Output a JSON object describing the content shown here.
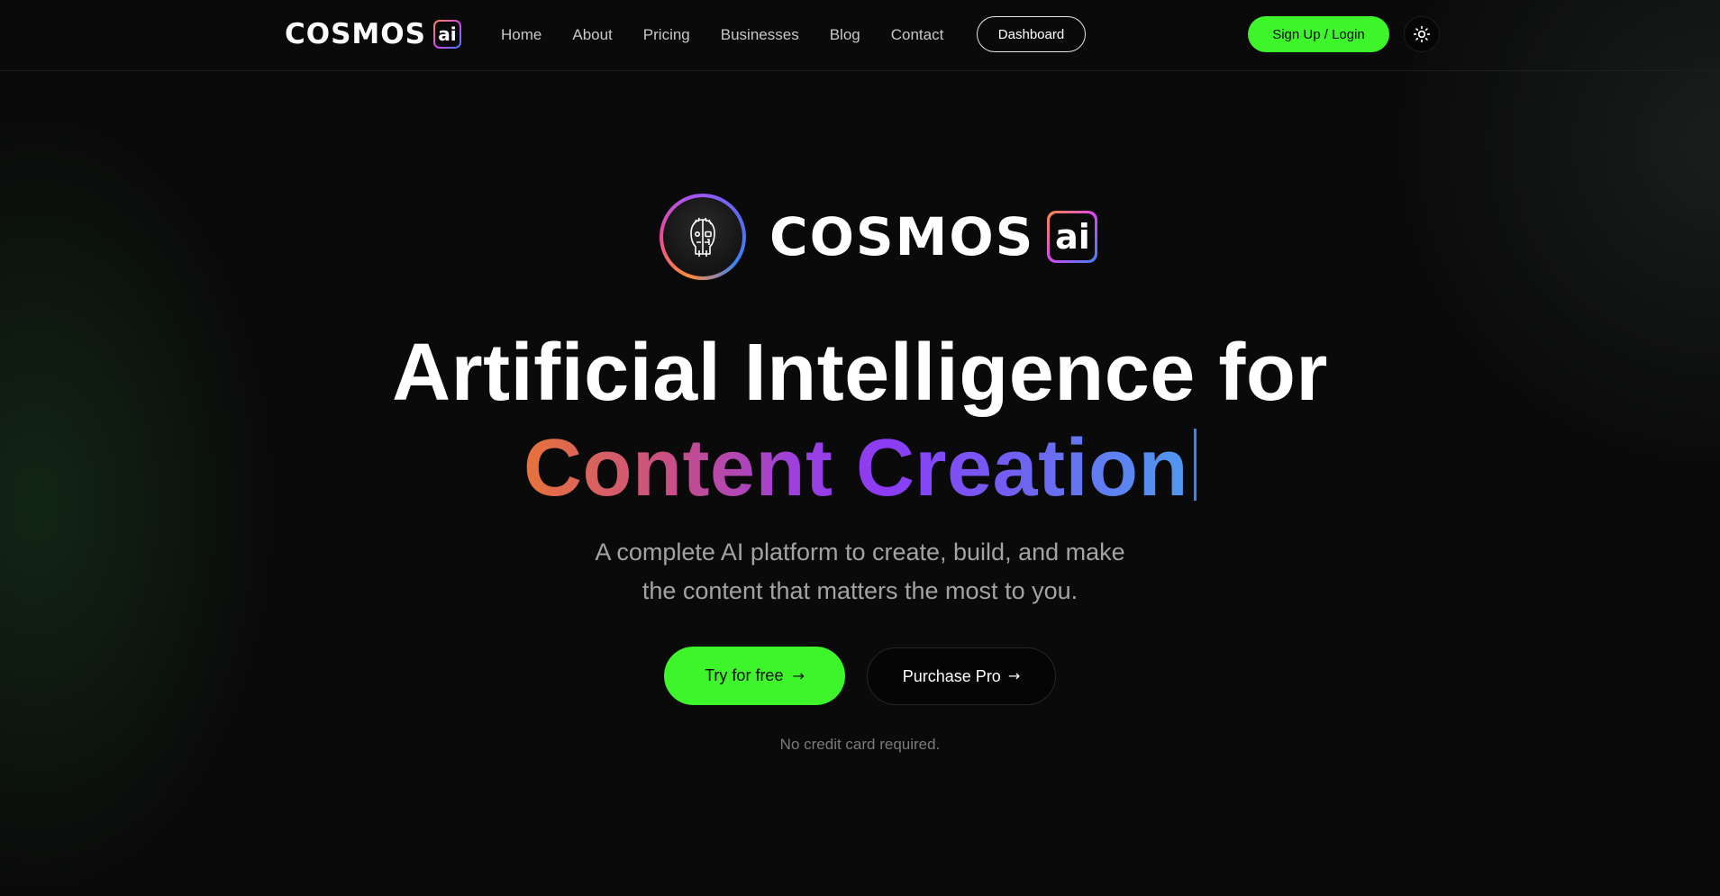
{
  "brand": {
    "wordmark": "COSMOS",
    "badge": "ai"
  },
  "nav": {
    "links": [
      "Home",
      "About",
      "Pricing",
      "Businesses",
      "Blog",
      "Contact"
    ],
    "dashboard_label": "Dashboard",
    "signup_label": "Sign Up / Login",
    "theme_icon": "sun-icon"
  },
  "hero": {
    "logo_icon": "robot-face-icon",
    "headline_line1": "Artificial Intelligence for",
    "headline_word1": "Content",
    "headline_word2": "Creation",
    "subtext_line1": "A complete AI platform to create, build, and make",
    "subtext_line2": "the content that matters the most to you.",
    "try_label": "Try for free",
    "pro_label": "Purchase Pro",
    "note": "No credit card required."
  },
  "colors": {
    "background": "#0a0a0a",
    "accent_green": "#3ef52c",
    "gradient": [
      "#e8733a",
      "#c84f86",
      "#8b3cf6",
      "#4f9af0"
    ]
  }
}
